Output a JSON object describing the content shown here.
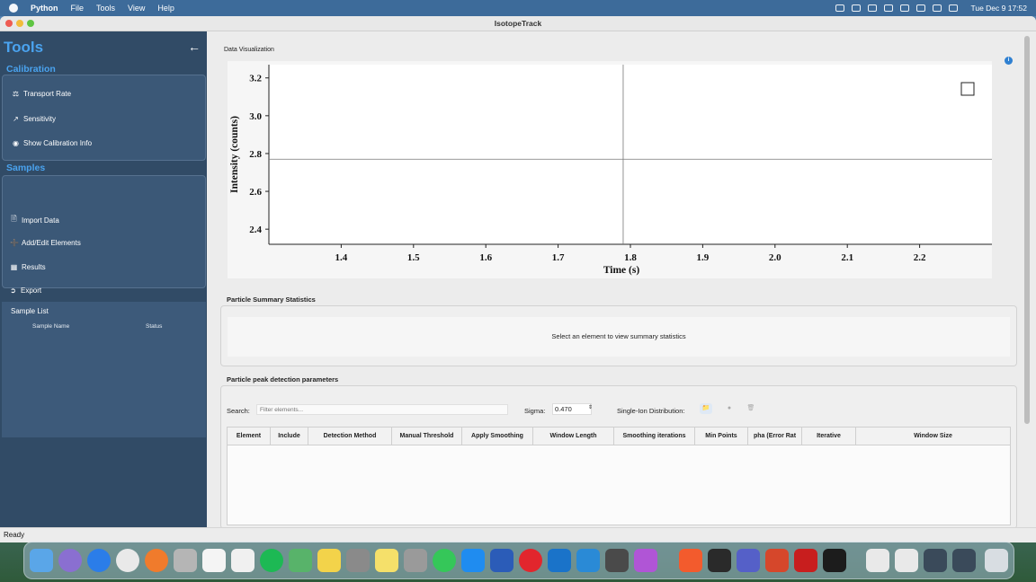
{
  "menubar": {
    "app_name": "Python",
    "menus": [
      "File",
      "Tools",
      "View",
      "Help"
    ],
    "clock": "Tue Dec 9  17:52"
  },
  "window": {
    "title": "IsotopeTrack"
  },
  "sidebar": {
    "title": "Tools",
    "calibration_title": "Calibration",
    "calibration_items": [
      {
        "label": "Transport Rate",
        "icon": "scale-icon"
      },
      {
        "label": "Sensitivity",
        "icon": "line-chart-icon"
      },
      {
        "label": "Show Calibration Info",
        "icon": "eye-icon"
      }
    ],
    "samples_title": "Samples",
    "sample_items": [
      {
        "label": "Import Data",
        "icon": "file-import-icon"
      },
      {
        "label": "Add/Edit Elements",
        "icon": "plus-icon"
      },
      {
        "label": "Results",
        "icon": "table-icon"
      },
      {
        "label": "Export",
        "icon": "export-icon"
      }
    ],
    "sample_list": {
      "title": "Sample List",
      "columns": [
        "Sample Name",
        "Status"
      ]
    }
  },
  "visualization": {
    "label": "Data Visualization",
    "chart_data": {
      "type": "line",
      "xlabel": "Time (s)",
      "ylabel": "Intensity (counts)",
      "x_ticks": [
        "1.4",
        "1.5",
        "1.6",
        "1.7",
        "1.8",
        "1.9",
        "2.0",
        "2.1",
        "2.2"
      ],
      "y_ticks": [
        "2.4",
        "2.6",
        "2.8",
        "3.0",
        "3.2"
      ],
      "xlim": [
        1.3,
        2.3
      ],
      "ylim": [
        2.32,
        3.27
      ],
      "crosshair": {
        "x": 1.79,
        "y": 2.77
      },
      "series": []
    }
  },
  "summary": {
    "title": "Particle Summary Statistics",
    "message": "Select an element to view summary statistics"
  },
  "params": {
    "title": "Particle peak detection parameters",
    "search_label": "Search:",
    "search_placeholder": "Filter elements...",
    "sigma_label": "Sigma:",
    "sigma_value": "0.470",
    "single_ion_label": "Single-Ion Distribution:",
    "columns": [
      "Element",
      "Include",
      "Detection Method",
      "Manual Threshold",
      "Apply Smoothing",
      "Window Length",
      "Smoothing iterations",
      "Min Points",
      "pha (Error Rat",
      "Iterative",
      "Window Size"
    ]
  },
  "status_bar": {
    "text": "Ready"
  },
  "colors": {
    "sidebar_bg": "#314b66",
    "accent": "#4aa3ef",
    "info": "#2f80d1"
  }
}
